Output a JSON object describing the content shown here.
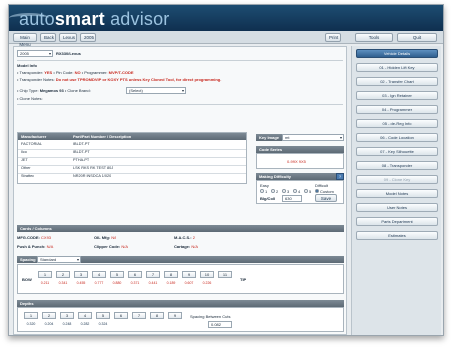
{
  "app": {
    "logo_prefix": "auto",
    "logo_strong": "smart",
    "logo_suffix": " advisor"
  },
  "toolbar": {
    "main_menu": "Main Menu",
    "back": "Back",
    "lexus": "Lexus",
    "year": "2005",
    "print": "Print",
    "tools": "Tools",
    "quit": "Quit"
  },
  "vehicle": {
    "year_value": "2005",
    "model_value": "RX330/Lexus"
  },
  "model_info": {
    "heading": "Model Info",
    "transponder_label": "• Transponder:",
    "transponder_value": "YES",
    "pin_label": "• Pin Code:",
    "pin_value": "NO",
    "programmer_label": "• Programmer:",
    "programmer_value": "MVP/T-CODE",
    "notes_label": "• Transponder Notes:",
    "notes_value": "Do not use TPROMDVIP or KOXY PTS unless Key Cloned Tool, for direct programming.",
    "chip_label": "• Chip Type:",
    "chip_value": "Megamos 93",
    "clone_label": "• Clone Brand:",
    "clone_value": "(Select)",
    "clone_notes_label": "• Clone Notes:"
  },
  "keys_table": {
    "headers": [
      "Manufacturer",
      "Part/Part Number / Description"
    ],
    "rows": [
      [
        "FACTORIAL",
        "IBLDT-PT"
      ],
      [
        "Ilco",
        "IBLDT-PT"
      ],
      [
        "JET",
        "PTHA-PT"
      ],
      [
        "Other",
        "LSK RKS RK TEST 80J"
      ],
      [
        "Strattec",
        "NR20R INSDCA 1/020"
      ]
    ]
  },
  "key_image": {
    "label": "Key Image",
    "value": "mt"
  },
  "code_series": {
    "label": "Code Series",
    "value": "0-99X 9X5"
  },
  "making_keys": {
    "label": "Making Difficulty",
    "easy": "Easy",
    "difficult": "Difficult",
    "scale": [
      "1",
      "2",
      "3",
      "4",
      "5"
    ],
    "custom_label": "Custom",
    "bitting_label": "Blg/Coll",
    "bitting_value": "630",
    "save_button": "Save"
  },
  "cards": {
    "heading": "Cards / Columns",
    "mfg_label": "MFG.CODE:",
    "mfg_value": "CX93",
    "oil_label": "OIL Mfg:",
    "oil_value": "N/I",
    "mac_label": "M.A.C.S.:",
    "mac_value": "2",
    "push_label": "Push & Punch:",
    "push_value": "N/A",
    "clipper_label": "Clipper Code:",
    "clipper_value": "N/A",
    "cartage_label": "Cartage:",
    "cartage_value": "N/A"
  },
  "spacing": {
    "label": "Spacing",
    "select_value": "Standard",
    "bow_label": "BOW",
    "tip_label": "TIP",
    "positions": [
      "1",
      "2",
      "3",
      "4",
      "5",
      "6",
      "7",
      "8",
      "9",
      "10",
      "11"
    ],
    "values": [
      "0.211",
      "0.341",
      "0.455",
      "0.777",
      "0.880",
      "0.371",
      "0.441",
      "0.189",
      "0.607",
      "0.226",
      ""
    ]
  },
  "depths": {
    "label": "Depths",
    "positions": [
      "1",
      "2",
      "3",
      "4",
      "5",
      "6",
      "7",
      "8",
      "9"
    ],
    "values": [
      "0.320",
      "0.204",
      "0.248",
      "0.282",
      "0.324",
      "",
      "",
      "",
      ""
    ],
    "spacing_label": "Spacing Between Cuts",
    "spacing_value": "0.082"
  },
  "sidebar": {
    "items": [
      "Vehicle Details",
      "01 - Hidden Lift Key",
      "02 - Transfer Chart",
      "03 - Ign Retainer",
      "04 - Programmer",
      "05 - de-Reg Info",
      "06 - Code Location",
      "07 - Key Silhouette",
      "08 - Transponder",
      "09 - Clone Key",
      "Model Notes",
      "User Notes",
      "Parts Department",
      "Estimates"
    ]
  },
  "colors": {
    "accent": "#2f5f8f",
    "banner": "#1d4d72",
    "alert": "#c8281e"
  }
}
